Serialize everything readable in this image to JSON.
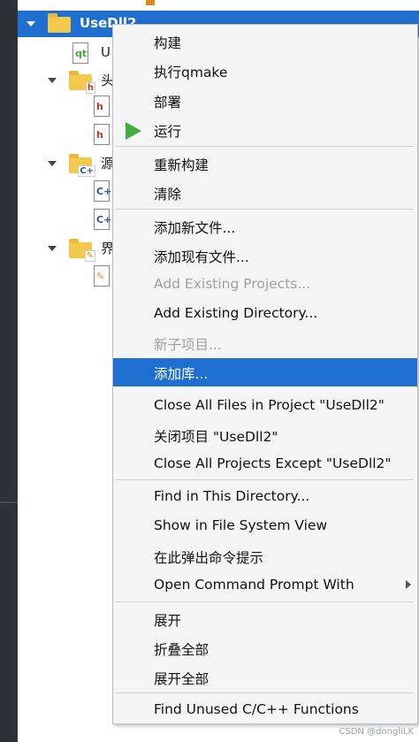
{
  "tree": {
    "project_name": "UseDll2",
    "partial_item": "U",
    "headers_partial": "头",
    "sources_partial": "源",
    "forms_partial": "界"
  },
  "menu": {
    "items": [
      {
        "label": "构建"
      },
      {
        "label": "执行qmake"
      },
      {
        "label": "部署"
      },
      {
        "label": "运行"
      },
      {
        "label": "重新构建"
      },
      {
        "label": "清除"
      },
      {
        "label": "添加新文件..."
      },
      {
        "label": "添加现有文件..."
      },
      {
        "label": "Add Existing Projects...",
        "disabled": true
      },
      {
        "label": "Add Existing Directory..."
      },
      {
        "label": "新子项目...",
        "disabled": true
      },
      {
        "label": "添加库...",
        "highlighted": true
      },
      {
        "label": "Close All Files in Project \"UseDll2\""
      },
      {
        "label": "关闭项目 \"UseDll2\""
      },
      {
        "label": "Close All Projects Except \"UseDll2\""
      },
      {
        "label": "Find in This Directory..."
      },
      {
        "label": "Show in File System View"
      },
      {
        "label": "在此弹出命令提示"
      },
      {
        "label": "Open Command Prompt With",
        "has_submenu": true
      },
      {
        "label": "展开"
      },
      {
        "label": "折叠全部"
      },
      {
        "label": "展开全部"
      },
      {
        "label": "Find Unused C/C++ Functions"
      }
    ]
  },
  "watermark": "CSDN @dongliLK",
  "colors": {
    "highlight": "#1f6fd1",
    "run_icon": "#3fae3f",
    "folder": "#f2c94c"
  }
}
